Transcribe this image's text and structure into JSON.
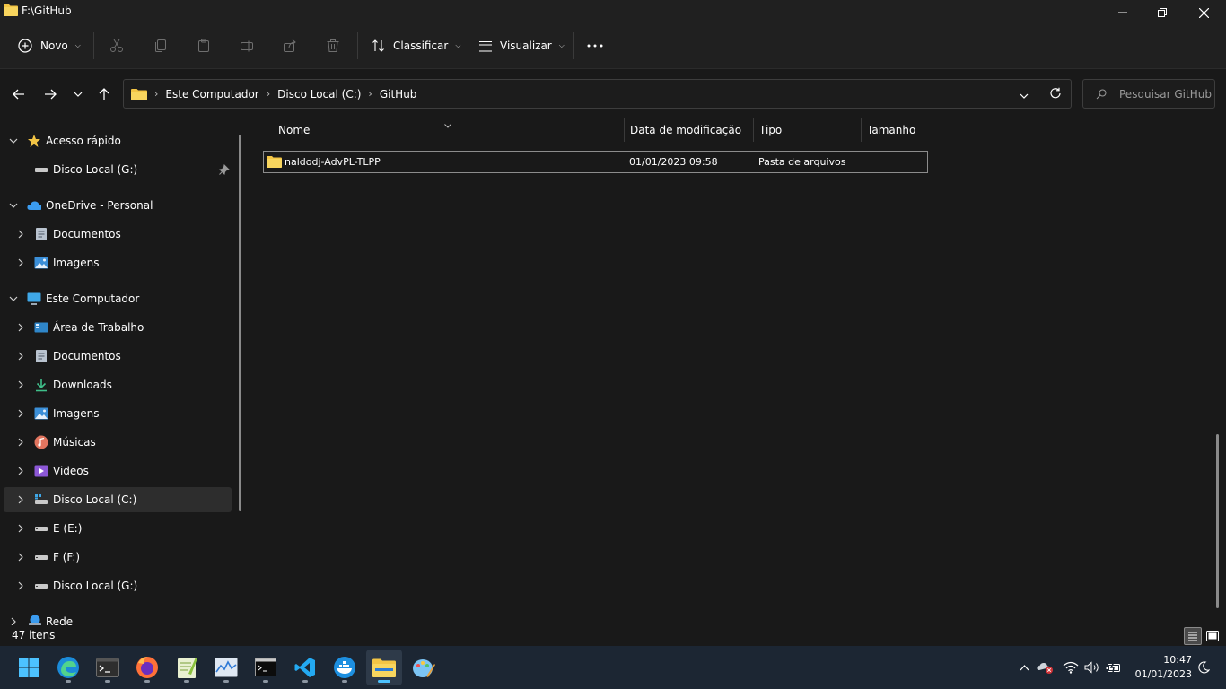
{
  "window": {
    "title": "F:\\GitHub"
  },
  "commandbar": {
    "new_label": "Novo",
    "sort_label": "Classificar",
    "view_label": "Visualizar"
  },
  "breadcrumb": [
    "Este Computador",
    "Disco Local (C:)",
    "GitHub"
  ],
  "search": {
    "placeholder": "Pesquisar GitHub"
  },
  "sidebar": {
    "items": [
      {
        "label": "Acesso rápido",
        "icon": "star-icon"
      },
      {
        "label": "Disco Local (G:)",
        "icon": "drive-icon"
      },
      {
        "label": "OneDrive - Personal",
        "icon": "cloud-icon"
      },
      {
        "label": "Documentos",
        "icon": "document-icon"
      },
      {
        "label": "Imagens",
        "icon": "image-icon"
      },
      {
        "label": "Este Computador",
        "icon": "computer-icon"
      },
      {
        "label": "Área de Trabalho",
        "icon": "desktop-icon"
      },
      {
        "label": "Documentos",
        "icon": "document-icon"
      },
      {
        "label": "Downloads",
        "icon": "download-icon"
      },
      {
        "label": "Imagens",
        "icon": "image-icon"
      },
      {
        "label": "Músicas",
        "icon": "music-icon"
      },
      {
        "label": "Videos",
        "icon": "video-icon"
      },
      {
        "label": "Disco Local (C:)",
        "icon": "system-drive-icon"
      },
      {
        "label": "E (E:)",
        "icon": "drive-icon"
      },
      {
        "label": "F (F:)",
        "icon": "drive-icon"
      },
      {
        "label": "Disco Local (G:)",
        "icon": "drive-icon"
      },
      {
        "label": "Rede",
        "icon": "network-icon"
      }
    ]
  },
  "columns": [
    "Nome",
    "Data de modificação",
    "Tipo",
    "Tamanho"
  ],
  "files": [
    {
      "name": "naldodj-AdvPL-TLPP",
      "modified": "01/01/2023 09:58",
      "type": "Pasta de arquivos",
      "size": ""
    }
  ],
  "status": {
    "count": "47 itens"
  },
  "taskbar": {
    "apps": [
      "start-icon",
      "edge-icon",
      "terminal-icon",
      "firefox-icon",
      "notepad-plus-icon",
      "resource-monitor-icon",
      "cmd-icon",
      "vscode-icon",
      "docker-icon",
      "file-explorer-icon",
      "paint-icon"
    ],
    "time": "10:47",
    "date": "01/01/2023"
  },
  "colors": {
    "accent": "#4cc2ff",
    "folder": "#f3c545",
    "taskbar": "#1c2633"
  }
}
